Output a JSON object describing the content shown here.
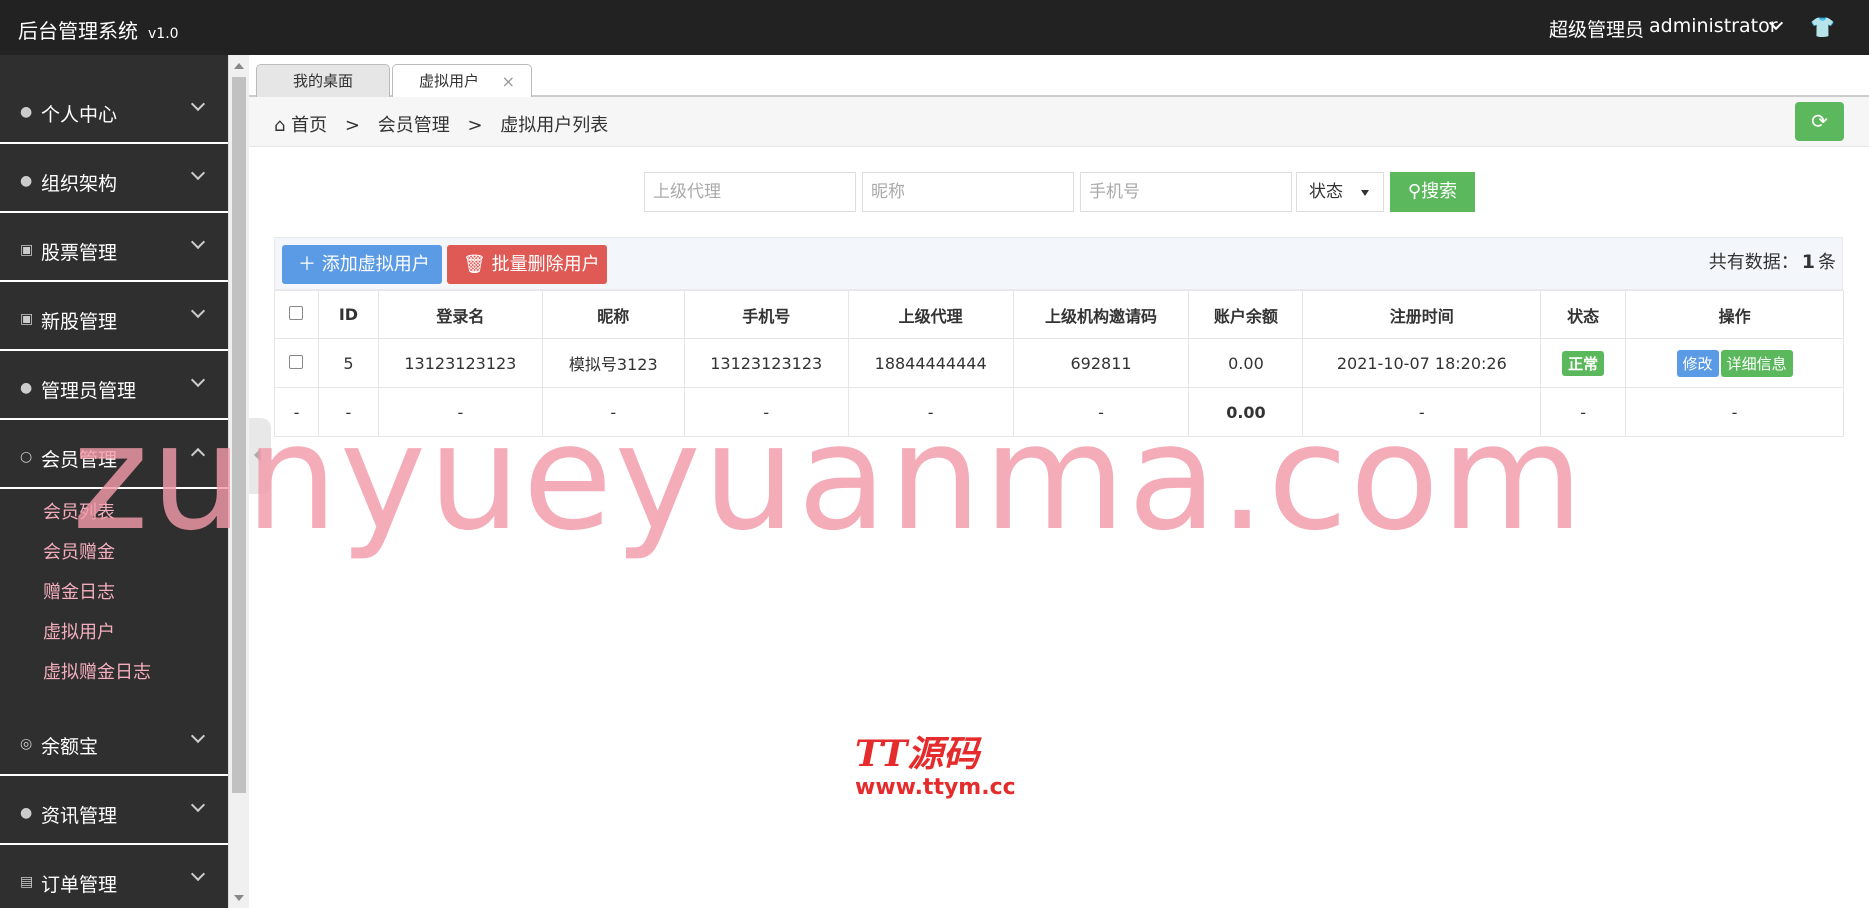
{
  "app": {
    "title": "后台管理系统",
    "version": "v1.0"
  },
  "header": {
    "role": "超级管理员",
    "username": "administrator",
    "theme_icon": "shirt-icon"
  },
  "sidebar": {
    "groups": [
      {
        "label": "个人中心",
        "icon": "user-icon"
      },
      {
        "label": "组织架构",
        "icon": "group-icon"
      },
      {
        "label": "股票管理",
        "icon": "briefcase-icon"
      },
      {
        "label": "新股管理",
        "icon": "briefcase-icon"
      },
      {
        "label": "管理员管理",
        "icon": "user-icon"
      },
      {
        "label": "会员管理",
        "icon": "member-icon",
        "expanded": true
      },
      {
        "label": "余额宝",
        "icon": "coin-icon"
      },
      {
        "label": "资讯管理",
        "icon": "group-icon"
      },
      {
        "label": "订单管理",
        "icon": "document-icon"
      }
    ],
    "member_items": [
      "会员列表",
      "会员赠金",
      "赠金日志",
      "虚拟用户",
      "虚拟赠金日志"
    ]
  },
  "tabs": [
    {
      "label": "我的桌面"
    },
    {
      "label": "虚拟用户",
      "close": "×",
      "active": true
    }
  ],
  "breadcrumb": {
    "home": "首页",
    "sep": ">",
    "level1": "会员管理",
    "level2": "虚拟用户列表"
  },
  "search": {
    "agent_placeholder": "上级代理",
    "nickname_placeholder": "昵称",
    "phone_placeholder": "手机号",
    "status_selected": "状态",
    "button_label": "搜索"
  },
  "toolbar": {
    "add_label": "添加虚拟用户",
    "batch_delete_label": "批量删除用户",
    "total_prefix": "共有数据：",
    "total_count": "1",
    "total_suffix": "条"
  },
  "table": {
    "headers": [
      "ID",
      "登录名",
      "昵称",
      "手机号",
      "上级代理",
      "上级机构邀请码",
      "账户余额",
      "注册时间",
      "状态",
      "操作"
    ],
    "rows": [
      {
        "id": "5",
        "login": "13123123123",
        "nickname": "模拟号3123",
        "phone": "13123123123",
        "agent": "18844444444",
        "invite_code": "692811",
        "balance": "0.00",
        "reg_time": "2021-10-07 18:20:26",
        "status": "正常",
        "edit_label": "修改",
        "detail_label": "详细信息"
      }
    ],
    "summary": {
      "dash": "-",
      "balance": "0.00"
    }
  },
  "overlay": {
    "watermark": "zunyueyuanma.com",
    "logo_line1": "TT源码",
    "logo_line2": "www.ttym.cc"
  },
  "colors": {
    "topbar": "#222222",
    "sidebar": "#2f2f2f",
    "accent_green": "#5cb85c",
    "accent_blue": "#5b9be6",
    "accent_red": "#e05a55",
    "submenu_text": "#f4aebe"
  }
}
